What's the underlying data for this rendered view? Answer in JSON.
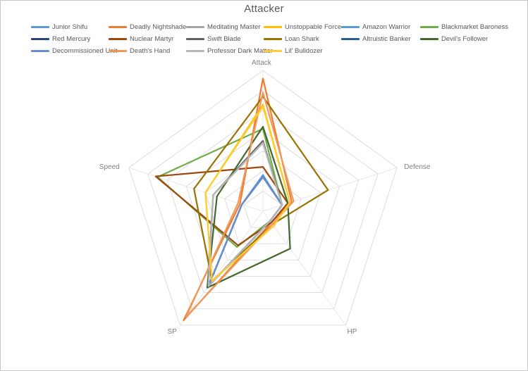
{
  "chart": {
    "title": "Attacker"
  },
  "axis_labels": {
    "attack": "Attack",
    "defense": "Defense",
    "hp": "HP",
    "sp": "SP",
    "speed": "Speed"
  },
  "colors": {
    "junior_shifu": "#5B9BD5",
    "deadly_nightshade": "#ED7D31",
    "meditating_master": "#A5A5A5",
    "unstoppable_force": "#FFC000",
    "amazon_warrior": "#5B9BD5",
    "blackmarket_baroness": "#70AD47",
    "red_mercury": "#264478",
    "nuclear_martyr": "#9E480E",
    "swift_blade": "#636363",
    "loan_shark": "#997300",
    "altruistic_banker": "#255E91",
    "devils_follower": "#43682B",
    "decommissioned_unit": "#698ED0",
    "deaths_hand": "#F1975A",
    "professor_dark_matter": "#B7B7B7",
    "lil_bulldozer": "#FFCD33",
    "grid": "#D9D9D9"
  },
  "chart_data": {
    "type": "radar",
    "title": "Attacker",
    "categories": [
      "Attack",
      "Defense",
      "HP",
      "SP",
      "Speed"
    ],
    "rings": 7,
    "rmax": 7,
    "grid": true,
    "legend_position": "top",
    "series": [
      {
        "name": "Junior Shifu",
        "color": "#5B9BD5",
        "values": [
          1.7,
          1.0,
          0.6,
          4.6,
          1.1
        ]
      },
      {
        "name": "Deadly Nightshade",
        "color": "#ED7D31",
        "values": [
          6.6,
          1.5,
          0.7,
          6.7,
          1.2
        ]
      },
      {
        "name": "Meditating Master",
        "color": "#A5A5A5",
        "values": [
          3.4,
          1.0,
          0.6,
          4.7,
          2.6
        ]
      },
      {
        "name": "Unstoppable Force",
        "color": "#FFC000",
        "values": [
          5.3,
          1.4,
          0.9,
          4.3,
          3.0
        ]
      },
      {
        "name": "Amazon Warrior",
        "color": "#5B9BD5",
        "values": [
          1.8,
          1.0,
          0.6,
          4.6,
          1.1
        ]
      },
      {
        "name": "Blackmarket Baroness",
        "color": "#70AD47",
        "values": [
          4.1,
          1.0,
          0.6,
          2.2,
          5.5
        ]
      },
      {
        "name": "Red Mercury",
        "color": "#264478",
        "values": [
          1.7,
          1.0,
          0.6,
          4.6,
          1.1
        ]
      },
      {
        "name": "Nuclear Martyr",
        "color": "#9E480E",
        "values": [
          2.2,
          1.3,
          0.7,
          2.1,
          5.6
        ]
      },
      {
        "name": "Swift Blade",
        "color": "#636363",
        "values": [
          3.5,
          1.0,
          0.6,
          4.6,
          2.6
        ]
      },
      {
        "name": "Loan Shark",
        "color": "#997300",
        "values": [
          5.7,
          3.4,
          0.8,
          4.3,
          3.6
        ]
      },
      {
        "name": "Altruistic Banker",
        "color": "#255E91",
        "values": [
          1.7,
          1.0,
          0.6,
          4.6,
          1.1
        ]
      },
      {
        "name": "Devil's Follower",
        "color": "#43682B",
        "values": [
          4.2,
          1.3,
          2.3,
          4.7,
          2.4
        ]
      },
      {
        "name": "Decommissioned Unit",
        "color": "#698ED0",
        "values": [
          1.7,
          1.0,
          0.6,
          4.6,
          1.1
        ]
      },
      {
        "name": "Death's Hand",
        "color": "#F1975A",
        "values": [
          5.9,
          1.6,
          0.8,
          6.5,
          1.3
        ]
      },
      {
        "name": "Professor Dark Matter",
        "color": "#B7B7B7",
        "values": [
          3.4,
          1.0,
          0.6,
          4.6,
          2.6
        ]
      },
      {
        "name": "Lil' Bulldozer",
        "color": "#FFCD33",
        "values": [
          5.2,
          1.4,
          0.9,
          4.3,
          3.0
        ]
      }
    ]
  },
  "legend": {
    "items": [
      {
        "label": "Junior Shifu",
        "color": "#5B9BD5"
      },
      {
        "label": "Deadly Nightshade",
        "color": "#ED7D31"
      },
      {
        "label": "Meditating Master",
        "color": "#A5A5A5"
      },
      {
        "label": "Unstoppable Force",
        "color": "#FFC000"
      },
      {
        "label": "Amazon Warrior",
        "color": "#5B9BD5"
      },
      {
        "label": "Blackmarket Baroness",
        "color": "#70AD47"
      },
      {
        "label": "Red Mercury",
        "color": "#264478"
      },
      {
        "label": "Nuclear Martyr",
        "color": "#9E480E"
      },
      {
        "label": "Swift Blade",
        "color": "#636363"
      },
      {
        "label": "Loan Shark",
        "color": "#997300"
      },
      {
        "label": "Altruistic Banker",
        "color": "#255E91"
      },
      {
        "label": "Devil's Follower",
        "color": "#43682B"
      },
      {
        "label": "Decommissioned Unit",
        "color": "#698ED0"
      },
      {
        "label": "Death's Hand",
        "color": "#F1975A"
      },
      {
        "label": "Professor Dark Matter",
        "color": "#B7B7B7"
      },
      {
        "label": "Lil' Bulldozer",
        "color": "#FFCD33"
      }
    ]
  }
}
